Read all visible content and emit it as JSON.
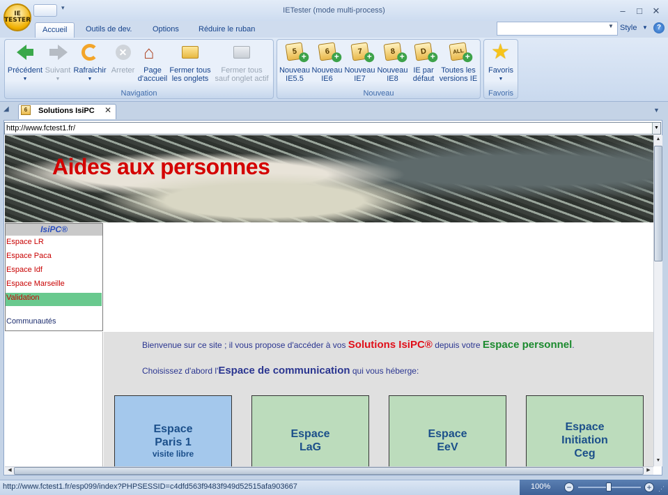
{
  "window": {
    "title": "IETester (mode multi-process)",
    "orb_label": "IE TESTER",
    "minimize": "–",
    "maximize": "□",
    "close": "✕"
  },
  "ribbon_tabs": [
    {
      "label": "Accueil",
      "active": true
    },
    {
      "label": "Outils de dev."
    },
    {
      "label": "Options"
    },
    {
      "label": "Réduire le ruban"
    }
  ],
  "ribbon_right": {
    "search_value": "",
    "style_label": "Style",
    "help": "?"
  },
  "ribbon": {
    "navigation": {
      "label": "Navigation",
      "buttons": [
        {
          "label": "Précédent",
          "dropdown": true,
          "enabled": true
        },
        {
          "label": "Suivant",
          "dropdown": true,
          "enabled": false
        },
        {
          "label": "Rafraichir",
          "dropdown": true,
          "enabled": true
        },
        {
          "label": "Arreter",
          "enabled": false
        },
        {
          "label": "Page d'accueil",
          "line1": "Page",
          "line2": "d'accueil",
          "enabled": true
        },
        {
          "label": "Fermer tous les onglets",
          "line1": "Fermer tous",
          "line2": "les onglets",
          "enabled": true
        },
        {
          "label": "Fermer tous sauf onglet actif",
          "line1": "Fermer tous",
          "line2": "sauf onglet actif",
          "enabled": false
        }
      ]
    },
    "nouveau": {
      "label": "Nouveau",
      "buttons": [
        {
          "line1": "Nouveau",
          "line2": "IE5.5",
          "badge": "5"
        },
        {
          "line1": "Nouveau",
          "line2": "IE6",
          "badge": "6"
        },
        {
          "line1": "Nouveau",
          "line2": "IE7",
          "badge": "7"
        },
        {
          "line1": "Nouveau",
          "line2": "IE8",
          "badge": "8"
        },
        {
          "line1": "IE par",
          "line2": "défaut",
          "badge": "D"
        },
        {
          "line1": "Toutes les",
          "line2": "versions IE",
          "badge": "ALL"
        }
      ]
    },
    "favoris": {
      "label": "Favoris",
      "button": "Favoris"
    }
  },
  "doc_tab": {
    "badge": "6",
    "title": "Solutions IsiPC",
    "close": "✕"
  },
  "address": {
    "url": "http://www.fctest1.fr/"
  },
  "page": {
    "banner_title": "Aides aux personnes",
    "sidenav": {
      "header": "IsiPC®",
      "items": [
        {
          "label": "Espace LR"
        },
        {
          "label": "Espace Paca"
        },
        {
          "label": "Espace Idf"
        },
        {
          "label": "Espace Marseille"
        },
        {
          "label": "Validation",
          "highlighted": true
        },
        {
          "label": "Communautés"
        }
      ]
    },
    "intro1_before": "Bienvenue sur ce site ; il vous propose d'accéder à vos ",
    "intro1_brand": "Solutions IsiPC®",
    "intro1_middle": " depuis votre ",
    "intro1_space": "Espace personnel",
    "intro1_end": ".",
    "intro2_before": "Choisissez d'abord l'",
    "intro2_em": "Espace de communication",
    "intro2_after": " qui vous héberge:",
    "cards": [
      {
        "line1": "Espace",
        "line2": "Paris 1",
        "line3": "visite libre",
        "color": "#a4c8ec"
      },
      {
        "line1": "Espace",
        "line2": "LaG",
        "color": "#bcdcbc"
      },
      {
        "line1": "Espace",
        "line2": "EeV",
        "color": "#bcdcbc"
      },
      {
        "line1": "Espace",
        "line2": "Initiation",
        "line3": "Ceg",
        "color": "#bcdcbc"
      }
    ]
  },
  "status": {
    "text": "http://www.fctest1.fr/esp099/index?PHPSESSID=c4dfd563f9483f949d52515afa903667",
    "zoom": "100%",
    "zoom_out": "−",
    "zoom_in": "+"
  }
}
